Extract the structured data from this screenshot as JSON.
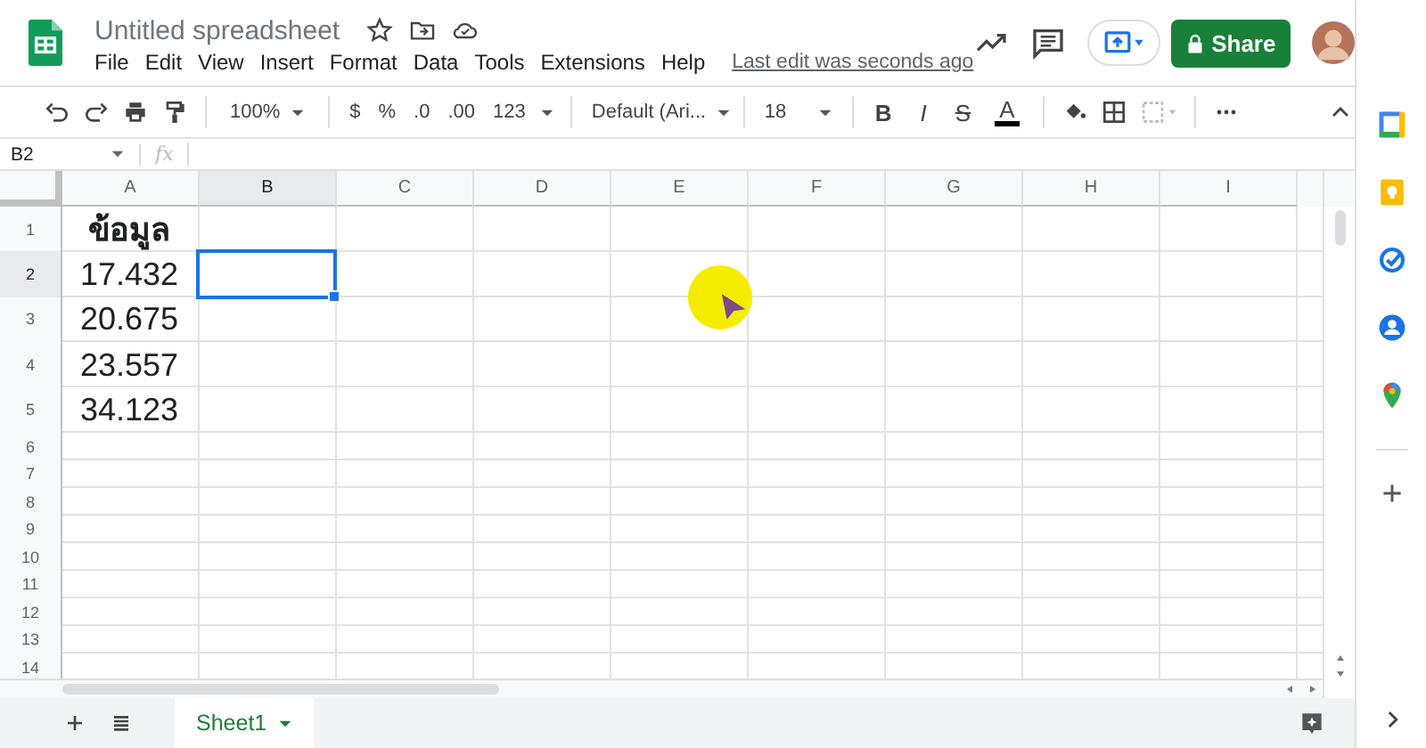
{
  "document": {
    "title": "Untitled spreadsheet",
    "last_edit": "Last edit was seconds ago"
  },
  "menu": [
    "File",
    "Edit",
    "View",
    "Insert",
    "Format",
    "Data",
    "Tools",
    "Extensions",
    "Help"
  ],
  "share_button": {
    "label": "Share"
  },
  "toolbar": {
    "zoom": "100%",
    "number_formats": [
      "$",
      "%",
      ".0",
      ".00",
      "123"
    ],
    "font": "Default (Ari...",
    "font_size": "18",
    "text_formats": [
      "B",
      "I",
      "S",
      "A"
    ]
  },
  "formula_bar": {
    "cell_ref": "B2",
    "fx": "fx"
  },
  "columns": [
    {
      "label": "A",
      "selected": false
    },
    {
      "label": "B",
      "selected": true
    },
    {
      "label": "C",
      "selected": false
    },
    {
      "label": "D",
      "selected": false
    },
    {
      "label": "E",
      "selected": false
    },
    {
      "label": "F",
      "selected": false
    },
    {
      "label": "G",
      "selected": false
    },
    {
      "label": "H",
      "selected": false
    },
    {
      "label": "I",
      "selected": false
    }
  ],
  "rows": [
    {
      "label": "1",
      "selected": false,
      "cells": [
        {
          "text": "ข้อมูล",
          "bold": true,
          "selected": false
        }
      ]
    },
    {
      "label": "2",
      "selected": true,
      "cells": [
        {
          "text": "17.432",
          "bold": false,
          "selected": false
        },
        {
          "selected": true
        }
      ]
    },
    {
      "label": "3",
      "selected": false,
      "cells": [
        {
          "text": "20.675",
          "bold": false,
          "selected": false
        }
      ]
    },
    {
      "label": "4",
      "selected": false,
      "cells": [
        {
          "text": "23.557",
          "bold": false,
          "selected": false
        }
      ]
    },
    {
      "label": "5",
      "selected": false,
      "cells": [
        {
          "text": "34.123",
          "bold": false,
          "selected": false
        }
      ]
    },
    {
      "label": "6",
      "selected": false
    },
    {
      "label": "7",
      "selected": false
    },
    {
      "label": "8",
      "selected": false
    },
    {
      "label": "9",
      "selected": false
    },
    {
      "label": "10",
      "selected": false
    },
    {
      "label": "11",
      "selected": false
    },
    {
      "label": "12",
      "selected": false
    },
    {
      "label": "13",
      "selected": false
    },
    {
      "label": "14",
      "selected": false
    }
  ],
  "sheet_tabs": [
    {
      "label": "Sheet1",
      "selected": true
    }
  ]
}
